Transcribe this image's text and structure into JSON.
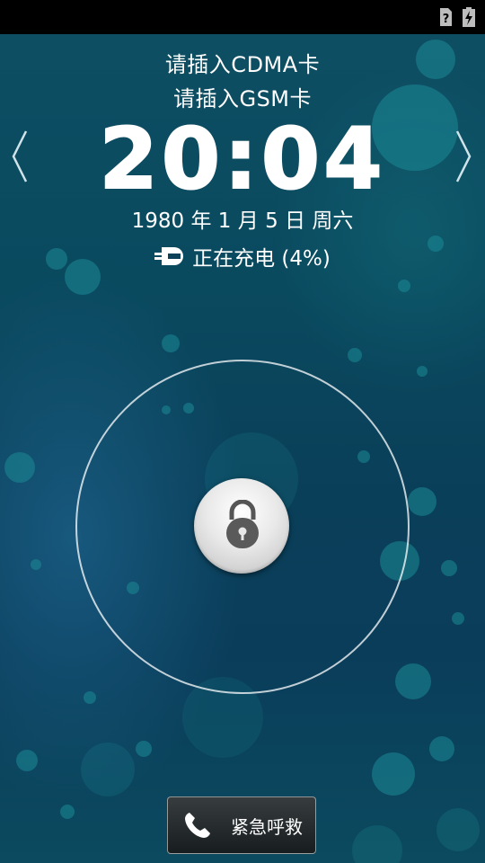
{
  "status_bar": {
    "icons": [
      "sim-missing-icon",
      "battery-charging-icon"
    ]
  },
  "lockscreen": {
    "carrier_line1": "请插入CDMA卡",
    "carrier_line2": "请插入GSM卡",
    "time": "20:04",
    "date": "1980 年 1 月 5 日 周六",
    "charging_status": "正在充电 (4%)",
    "battery_percent": 4
  },
  "emergency_button": {
    "label": "紧急呼救",
    "icon": "phone-icon"
  },
  "navigation": {
    "left_icon": "chevron-left-icon",
    "right_icon": "chevron-right-icon"
  },
  "unlock": {
    "icon": "lock-icon"
  }
}
